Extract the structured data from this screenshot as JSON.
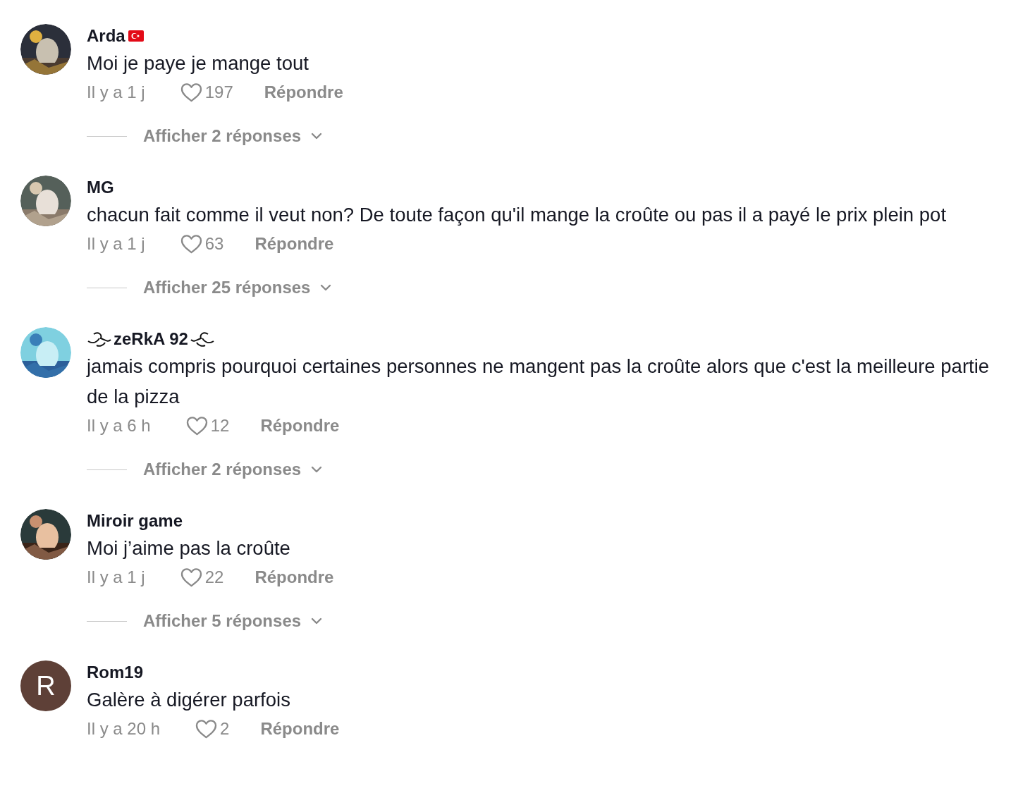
{
  "comments": [
    {
      "user": "Arda",
      "badge": {
        "kind": "flag"
      },
      "text": "Moi je paye je mange tout",
      "time": "Il y a 1 j",
      "likes": "197",
      "reply": "Répondre",
      "replies": "Afficher 2 réponses"
    },
    {
      "user": "MG",
      "text": "chacun fait comme il veut non? De toute façon qu'il mange la croûte ou pas il a payé le prix plein pot",
      "time": "Il y a 1 j",
      "likes": "63",
      "reply": "Répondre",
      "replies": "Afficher 25 réponses"
    },
    {
      "user": "zeRkA 92",
      "badge": {
        "kind": "ornament"
      },
      "text": "jamais compris pourquoi certaines personnes ne mangent pas la croûte alors que c'est la meilleure partie de la pizza",
      "time": "Il y a 6 h",
      "likes": "12",
      "reply": "Répondre",
      "replies": "Afficher 2 réponses"
    },
    {
      "user": "Miroir game",
      "text": "Moi j’aime pas la croûte",
      "time": "Il y a 1 j",
      "likes": "22",
      "reply": "Répondre",
      "replies": "Afficher 5 réponses"
    },
    {
      "user": "Rom19",
      "avatar": {
        "kind": "letter",
        "letter": "R",
        "color": "#5e4037"
      },
      "text": "Galère à digérer parfois",
      "time": "Il y a 20 h",
      "likes": "2",
      "reply": "Répondre"
    }
  ]
}
